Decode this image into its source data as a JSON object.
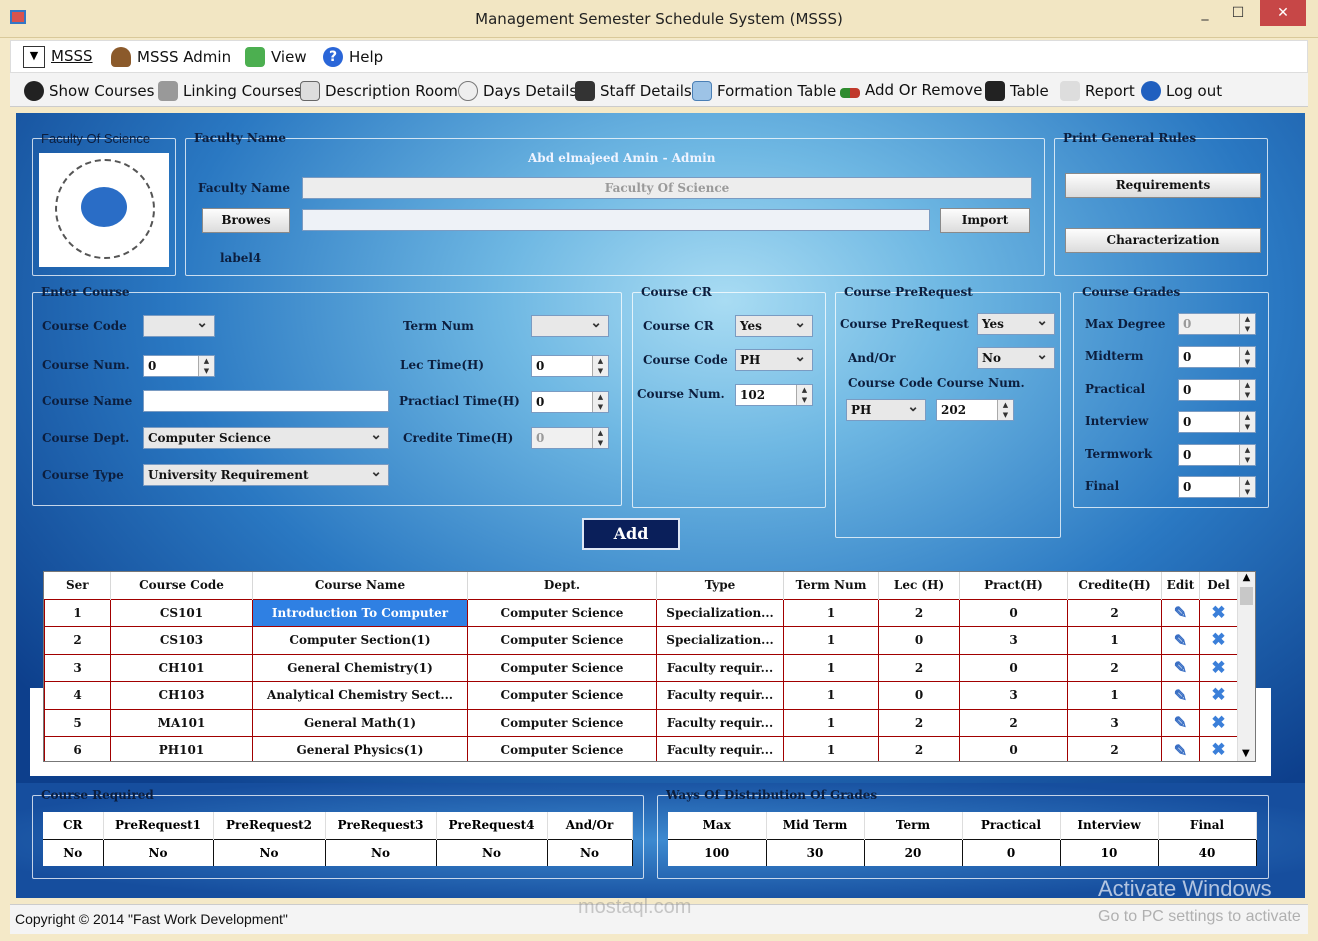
{
  "window": {
    "title": "Management Semester Schedule System (MSSS)",
    "minimize": "_",
    "maximize": "☐",
    "close": "✕"
  },
  "menu": [
    {
      "label": "MSSS"
    },
    {
      "label": "MSSS Admin"
    },
    {
      "label": "View"
    },
    {
      "label": "Help"
    }
  ],
  "toolbar": [
    {
      "label": "Show Courses"
    },
    {
      "label": "Linking Courses"
    },
    {
      "label": "Description Room"
    },
    {
      "label": "Days Details"
    },
    {
      "label": "Staff Details"
    },
    {
      "label": "Formation Table"
    },
    {
      "label": "Add Or Remove"
    },
    {
      "label": "Table"
    },
    {
      "label": "Report"
    },
    {
      "label": "Log out"
    }
  ],
  "faculty_box": {
    "title": "Faculty Of Science"
  },
  "faculty_name": {
    "title": "Faculty Name",
    "user": "Abd elmajeed Amin - Admin",
    "label": "Faculty Name",
    "value": "Faculty Of Science",
    "browse": "Browes",
    "import": "Import",
    "label4": "label4"
  },
  "print_rules": {
    "title": "Print General Rules",
    "requirements": "Requirements",
    "characterization": "Characterization"
  },
  "enter_course": {
    "title": "Enter Course",
    "code_label": "Course Code",
    "num_label": "Course Num.",
    "num_value": "0",
    "name_label": "Course Name",
    "dept_label": "Course Dept.",
    "dept_value": "Computer Science",
    "type_label": "Course Type",
    "type_value": "University Requirement",
    "term_label": "Term Num",
    "lec_label": "Lec Time(H)",
    "lec_value": "0",
    "prac_label": "Practiacl Time(H)",
    "prac_value": "0",
    "credit_label": "Credite Time(H)",
    "credit_value": "0"
  },
  "course_cr": {
    "title": "Course CR",
    "cr_label": "Course CR",
    "cr_value": "Yes",
    "code_label": "Course Code",
    "code_value": "PH",
    "num_label": "Course Num.",
    "num_value": "102"
  },
  "prereq": {
    "title": "Course PreRequest",
    "pr_label": "Course PreRequest",
    "pr_value": "Yes",
    "andor_label": "And/Or",
    "andor_value": "No",
    "code_num_label": "Course Code Course Num.",
    "code_value": "PH",
    "num_value": "202"
  },
  "grades": {
    "title": "Course Grades",
    "rows": [
      {
        "label": "Max Degree",
        "value": "0"
      },
      {
        "label": "Midterm",
        "value": "0"
      },
      {
        "label": "Practical",
        "value": "0"
      },
      {
        "label": "Interview",
        "value": "0"
      },
      {
        "label": "Termwork",
        "value": "0"
      },
      {
        "label": "Final",
        "value": "0"
      }
    ]
  },
  "add_button": "Add",
  "courses_table": {
    "headers": [
      "Ser",
      "Course Code",
      "Course Name",
      "Dept.",
      "Type",
      "Term Num",
      "Lec (H)",
      "Pract(H)",
      "Credite(H)",
      "Edit",
      "Del"
    ],
    "rows": [
      [
        "1",
        "CS101",
        "Introduction To Computer",
        "Computer Science",
        "Specialization...",
        "1",
        "2",
        "0",
        "2"
      ],
      [
        "2",
        "CS103",
        "Computer Section(1)",
        "Computer Science",
        "Specialization...",
        "1",
        "0",
        "3",
        "1"
      ],
      [
        "3",
        "CH101",
        "General Chemistry(1)",
        "Computer Science",
        "Faculty requir...",
        "1",
        "2",
        "0",
        "2"
      ],
      [
        "4",
        "CH103",
        "Analytical Chemistry Sect...",
        "Computer Science",
        "Faculty requir...",
        "1",
        "0",
        "3",
        "1"
      ],
      [
        "5",
        "MA101",
        "General Math(1)",
        "Computer Science",
        "Faculty requir...",
        "1",
        "2",
        "2",
        "3"
      ],
      [
        "6",
        "PH101",
        "General Physics(1)",
        "Computer Science",
        "Faculty requir...",
        "1",
        "2",
        "0",
        "2"
      ]
    ]
  },
  "course_required": {
    "title": "Course Required",
    "headers": [
      "CR",
      "PreRequest1",
      "PreRequest2",
      "PreRequest3",
      "PreRequest4",
      "And/Or"
    ],
    "row": [
      "No",
      "No",
      "No",
      "No",
      "No",
      "No"
    ]
  },
  "distribution": {
    "title": "Ways Of Distribution Of Grades",
    "headers": [
      "Max",
      "Mid Term",
      "Term",
      "Practical",
      "Interview",
      "Final"
    ],
    "row": [
      "100",
      "30",
      "20",
      "0",
      "10",
      "40"
    ]
  },
  "status": {
    "copyright": "Copyright © 2014 \"Fast Work Development\""
  },
  "overlay": {
    "activate": "Activate Windows",
    "activate_sub": "Go to PC settings to activate",
    "brand": "mostaql.com"
  }
}
